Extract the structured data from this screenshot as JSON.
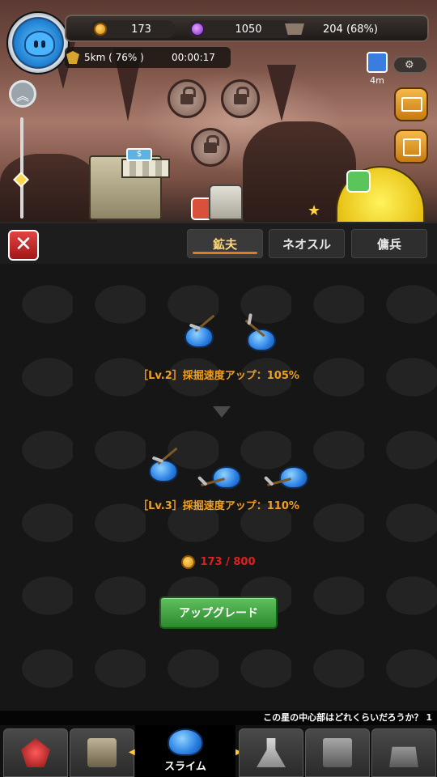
{
  "hud": {
    "coins": "173",
    "gems": "1050",
    "cart_capacity": "204 (68%)",
    "depth": "5km ( 76% )",
    "timer": "00:00:17",
    "boost_time": "4m",
    "shop_sign": "$"
  },
  "tabs": [
    {
      "label": "鉱夫",
      "active": true
    },
    {
      "label": "ネオスル",
      "active": false
    },
    {
      "label": "傭兵",
      "active": false
    }
  ],
  "upgrade": {
    "current_level_text": "［Lv.2］採掘速度アップ：105%",
    "next_level_text": "［Lv.3］採掘速度アップ：110%",
    "cost_text": "173 / 800",
    "button_label": "アップグレード"
  },
  "ticker": "この星の中心部はどれくらいだろうか？ 1",
  "bottom_nav": {
    "center_label": "スライム"
  },
  "colors": {
    "accent_orange": "#f0a020",
    "cost_red": "#e02020",
    "upgrade_green": "#3a9e3a",
    "close_red": "#d63030"
  }
}
